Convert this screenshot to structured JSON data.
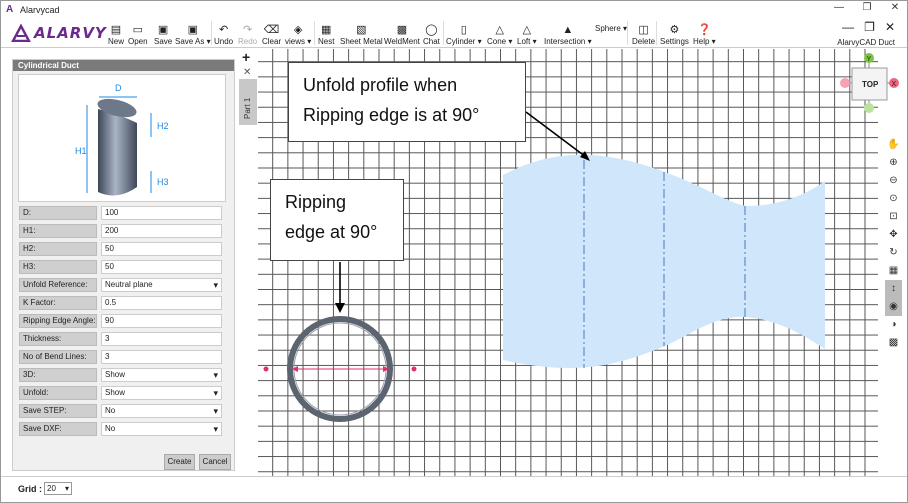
{
  "window": {
    "title": "Alarvycad",
    "controls": [
      "—",
      "❐",
      "✕"
    ]
  },
  "logo": {
    "text": "ALARVY"
  },
  "toolbar": {
    "items": [
      {
        "label": "New",
        "icon": "new-file-icon"
      },
      {
        "label": "Open",
        "icon": "folder-open-icon"
      },
      {
        "label": "Save",
        "icon": "save-icon"
      },
      {
        "label": "Save As ▾",
        "icon": "save-as-icon"
      },
      {
        "label": "Undo",
        "icon": "undo-icon"
      },
      {
        "label": "Redo",
        "icon": "redo-icon"
      },
      {
        "label": "Clear",
        "icon": "eraser-icon"
      },
      {
        "label": "views ▾",
        "icon": "cube-icon"
      },
      {
        "label": "Nest",
        "icon": "nest-icon"
      },
      {
        "label": "Sheet Metal",
        "icon": "sheet-metal-icon"
      },
      {
        "label": "WeldMent",
        "icon": "weldment-icon"
      },
      {
        "label": "Chat",
        "icon": "chat-icon"
      },
      {
        "label": "Cylinder ▾",
        "icon": "cylinder-icon"
      },
      {
        "label": "Cone ▾",
        "icon": "cone-icon"
      },
      {
        "label": "Loft ▾",
        "icon": "loft-icon"
      },
      {
        "label": "Intersection ▾",
        "icon": "intersection-icon"
      },
      {
        "label": "Sphere ▾",
        "icon": "sphere-icon"
      },
      {
        "label": "Delete",
        "icon": "trash-icon"
      },
      {
        "label": "Settings",
        "icon": "gear-icon"
      },
      {
        "label": "Help ▾",
        "icon": "help-icon"
      }
    ],
    "right_controls": [
      "—",
      "❐",
      "✕"
    ],
    "right_label": "AlarvyCAD Duct"
  },
  "panel": {
    "title": "Cylindrical Duct",
    "diagram_labels": {
      "d": "D",
      "h1": "H1",
      "h2": "H2",
      "h3": "H3"
    },
    "properties": [
      {
        "label": "D:",
        "value": "100",
        "select": false
      },
      {
        "label": "H1:",
        "value": "200",
        "select": false
      },
      {
        "label": "H2:",
        "value": "50",
        "select": false
      },
      {
        "label": "H3:",
        "value": "50",
        "select": false
      },
      {
        "label": "Unfold Reference:",
        "value": "Neutral plane",
        "select": true
      },
      {
        "label": "K Factor:",
        "value": "0.5",
        "select": false
      },
      {
        "label": "Ripping Edge Angle:",
        "value": "90",
        "select": false
      },
      {
        "label": "Thickness:",
        "value": "3",
        "select": false
      },
      {
        "label": "No of Bend Lines:",
        "value": "3",
        "select": false
      },
      {
        "label": "3D:",
        "value": "Show",
        "select": true
      },
      {
        "label": "Unfold:",
        "value": "Show",
        "select": true
      },
      {
        "label": "Save STEP:",
        "value": "No",
        "select": true
      },
      {
        "label": "Save DXF:",
        "value": "No",
        "select": true
      }
    ],
    "create_label": "Create",
    "cancel_label": "Cancel"
  },
  "tabs": {
    "add_label": "+",
    "close_label": "✕",
    "part_label": "Part 1"
  },
  "viewcube": {
    "face_label": "TOP",
    "y_axis": "Y",
    "x_axis": "X"
  },
  "callouts": {
    "unfold_line1": "Unfold profile when",
    "unfold_line2": "Ripping edge is at 90°",
    "ripping_line1": "Ripping",
    "ripping_line2": "edge at 90°"
  },
  "right_toolbar": [
    "hand-pan-icon",
    "zoom-in-icon",
    "zoom-out-icon",
    "zoom-fit-icon",
    "zoom-window-icon",
    "move-icon",
    "rotate-icon",
    "grid-icon",
    "dimension-icon",
    "eye-icon",
    "contrast-icon",
    "layers-icon"
  ],
  "bottom": {
    "grid_label": "Grid :",
    "grid_value": "20"
  },
  "colors": {
    "brand": "#6b2a8c",
    "unfold_fill": "#cfe6fb",
    "bend_line": "#4a78c8",
    "ring": "#5c6470",
    "dim_marker": "#e0306a"
  }
}
